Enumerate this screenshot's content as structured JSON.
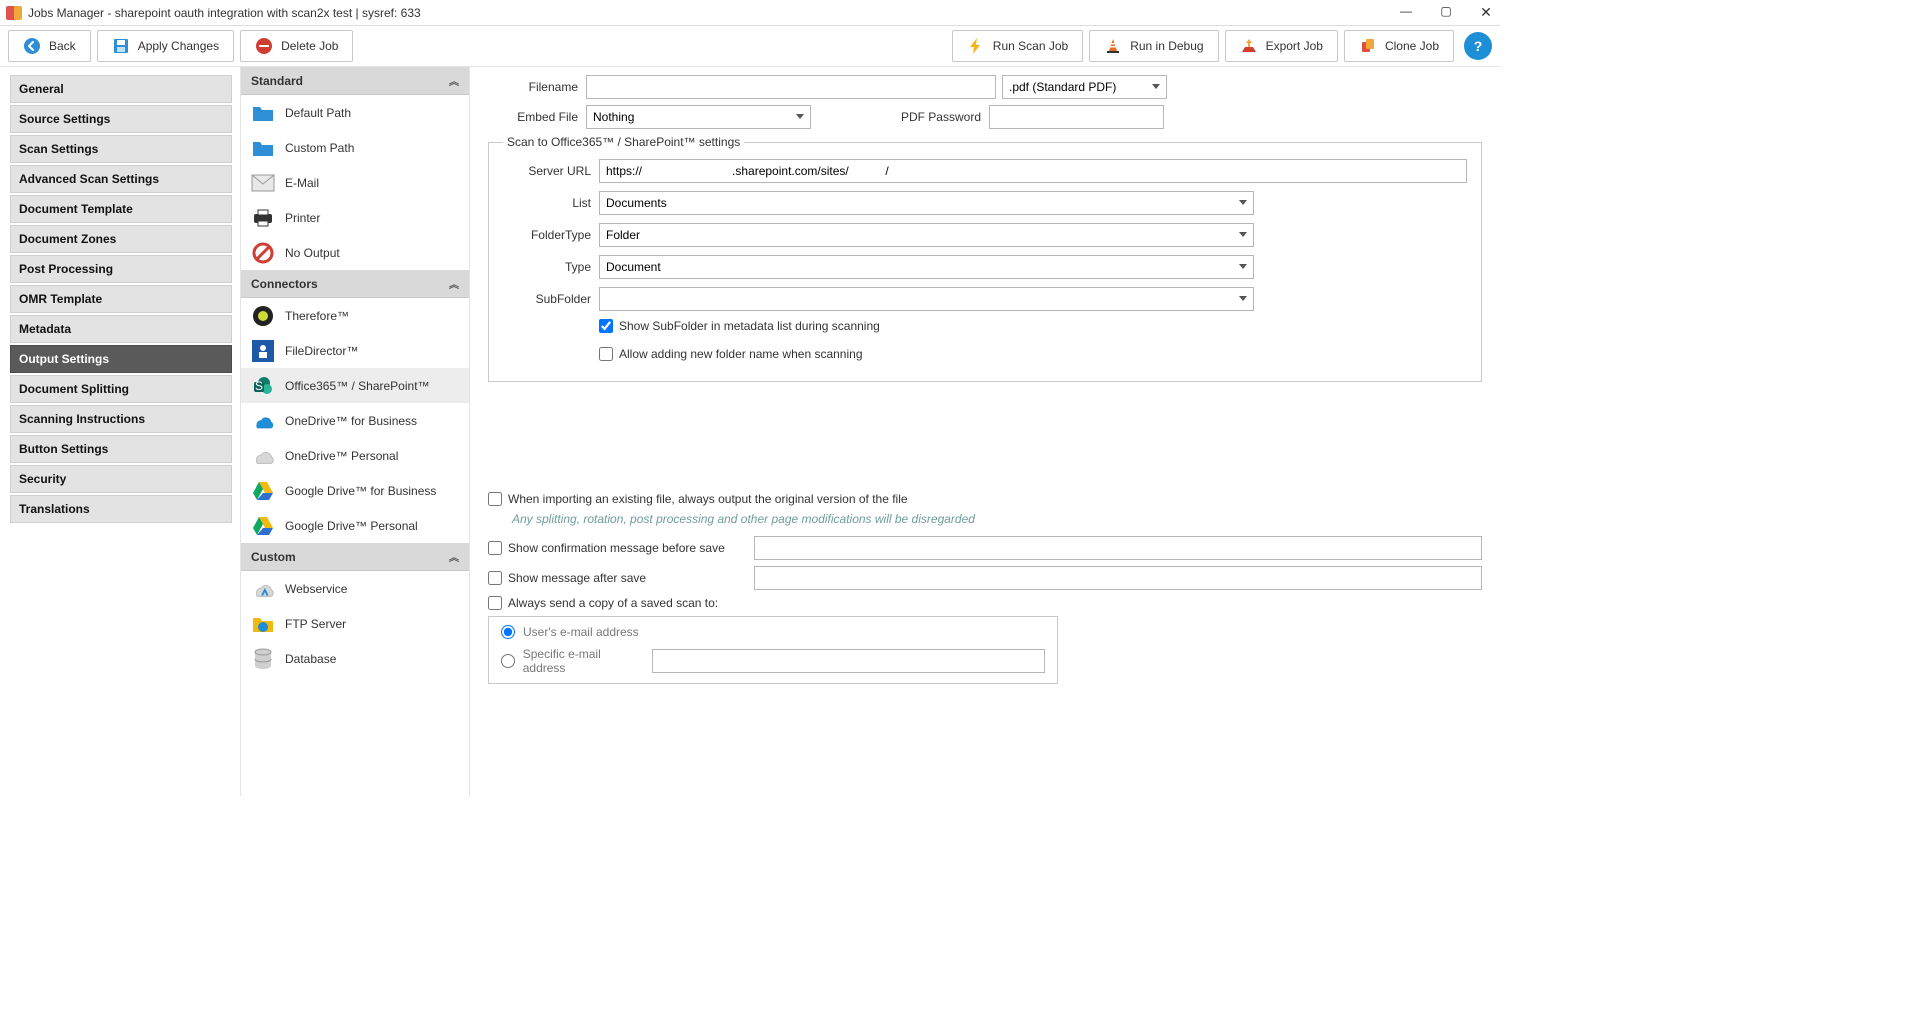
{
  "title": "Jobs Manager - sharepoint oauth integration with scan2x test  |  sysref: 633",
  "toolbar": {
    "back": "Back",
    "apply": "Apply Changes",
    "delete": "Delete Job",
    "run": "Run Scan Job",
    "debug": "Run in Debug",
    "export": "Export Job",
    "clone": "Clone Job"
  },
  "nav": [
    "General",
    "Source Settings",
    "Scan Settings",
    "Advanced Scan Settings",
    "Document Template",
    "Document Zones",
    "Post Processing",
    "OMR Template",
    "Metadata",
    "Output Settings",
    "Document Splitting",
    "Scanning Instructions",
    "Button Settings",
    "Security",
    "Translations"
  ],
  "nav_active": "Output Settings",
  "acc": {
    "standard": {
      "label": "Standard",
      "items": [
        "Default Path",
        "Custom Path",
        "E-Mail",
        "Printer",
        "No Output"
      ]
    },
    "connectors": {
      "label": "Connectors",
      "items": [
        "Therefore™",
        "FileDirector™",
        "Office365™ / SharePoint™",
        "OneDrive™ for Business",
        "OneDrive™ Personal",
        "Google Drive™ for Business",
        "Google Drive™ Personal"
      ],
      "selected": "Office365™ / SharePoint™"
    },
    "custom": {
      "label": "Custom",
      "items": [
        "Webservice",
        "FTP Server",
        "Database"
      ]
    }
  },
  "form": {
    "filename_label": "Filename",
    "filename_value": "",
    "file_ext": ".pdf (Standard PDF)",
    "embed_label": "Embed File",
    "embed_value": "Nothing",
    "pdf_pwd_label": "PDF Password",
    "pdf_pwd_value": "",
    "group_legend": "Scan to Office365™ / SharePoint™ settings",
    "server_url_label": "Server URL",
    "server_url_value": "https://                           .sharepoint.com/sites/           /",
    "list_label": "List",
    "list_value": "Documents",
    "foldertype_label": "FolderType",
    "foldertype_value": "Folder",
    "type_label": "Type",
    "type_value": "Document",
    "subfolder_label": "SubFolder",
    "subfolder_value": "",
    "cb_show_subfolder": "Show SubFolder in metadata list during scanning",
    "cb_allow_new_folder": "Allow adding new folder name when scanning",
    "cb_output_original": "When importing an existing file, always output the original version of the file",
    "hint_original": "Any splitting, rotation, post processing and other page modifications will be disregarded",
    "cb_confirm_before": "Show confirmation message before save",
    "cb_msg_after": "Show message after save",
    "cb_always_send": "Always send a copy of a saved scan to:",
    "radio_user_email": "User's e-mail address",
    "radio_specific_email": "Specific e-mail address",
    "specific_email_value": ""
  }
}
